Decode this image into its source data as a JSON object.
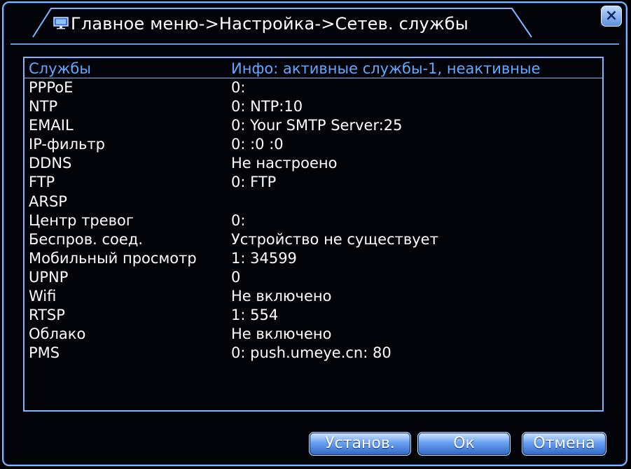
{
  "window": {
    "title": "Главное меню->Настройка->Сетев. службы",
    "close_symbol": "×"
  },
  "table": {
    "headers": {
      "service": "Службы",
      "info": "Инфо: активные службы-1, неактивные"
    },
    "rows": [
      {
        "service": "PPPoE",
        "info": "0:"
      },
      {
        "service": "NTP",
        "info": "0: NTP:10"
      },
      {
        "service": "EMAIL",
        "info": "0: Your SMTP Server:25"
      },
      {
        "service": "IP-фильтр",
        "info": "0: :0 :0"
      },
      {
        "service": "DDNS",
        "info": "Не настроено"
      },
      {
        "service": "FTP",
        "info": "0: FTP"
      },
      {
        "service": "ARSP",
        "info": ""
      },
      {
        "service": "Центр тревог",
        "info": "0:"
      },
      {
        "service": "Беспров. соед.",
        "info": "Устройство не существует"
      },
      {
        "service": "Мобильный просмотр",
        "info": "1: 34599"
      },
      {
        "service": "UPNP",
        "info": "0"
      },
      {
        "service": "Wifi",
        "info": "Не включено"
      },
      {
        "service": "RTSP",
        "info": "1: 554"
      },
      {
        "service": "Облако",
        "info": "Не включено"
      },
      {
        "service": "PMS",
        "info": "0: push.umeye.cn: 80"
      }
    ]
  },
  "buttons": {
    "set": "Установ.",
    "ok": "Ок",
    "cancel": "Отмена"
  },
  "icons": {
    "title": "monitor-icon",
    "close": "close-icon"
  },
  "colors": {
    "background": "#000000",
    "border": "#7fb6ff",
    "header_text": "#63a8ff",
    "text": "#ffffff"
  }
}
